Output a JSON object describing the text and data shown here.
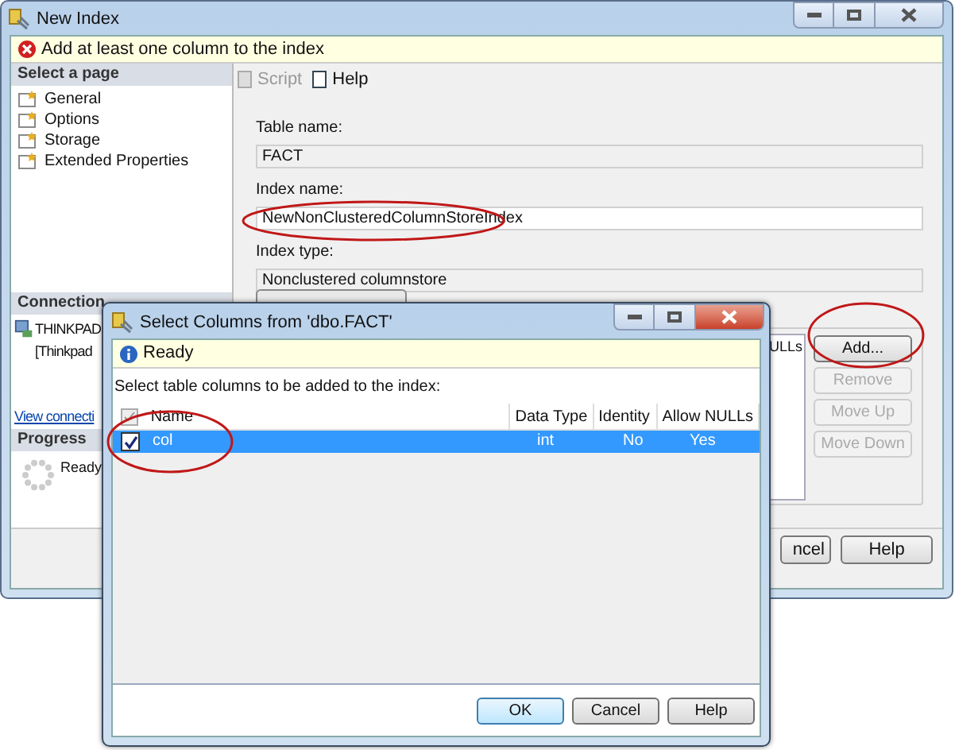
{
  "main_window": {
    "title": "New Index",
    "error": "Add at least one column to the index",
    "sidebar": {
      "header": "Select a page",
      "items": [
        {
          "label": "General"
        },
        {
          "label": "Options"
        },
        {
          "label": "Storage"
        },
        {
          "label": "Extended Properties"
        }
      ]
    },
    "connection": {
      "header": "Connection",
      "server": "THINKPAD",
      "user": "[Thinkpad",
      "link": "View connecti"
    },
    "progress": {
      "header": "Progress",
      "status": "Ready"
    },
    "toolbar": [
      {
        "label": "Script",
        "disabled": true
      },
      {
        "label": "Help",
        "disabled": false
      }
    ],
    "fields": [
      {
        "label": "Table name:",
        "value": "FACT",
        "editable": false
      },
      {
        "label": "Index name:",
        "value": "NewNonClusteredColumnStoreIndex",
        "editable": true
      },
      {
        "label": "Index type:",
        "value": "Nonclustered columnstore",
        "editable": false
      }
    ],
    "columns_list": {
      "header_fragment": "ULLs"
    },
    "side_buttons": [
      {
        "label": "Add...",
        "disabled": false
      },
      {
        "label": "Remove",
        "disabled": true
      },
      {
        "label": "Move Up",
        "disabled": true
      },
      {
        "label": "Move Down",
        "disabled": true
      }
    ],
    "footer_buttons": [
      "ncel",
      "Help"
    ]
  },
  "dialog": {
    "title": "Select Columns from 'dbo.FACT'",
    "status": "Ready",
    "prompt": "Select table columns to be added to the index:",
    "columns": [
      "Name",
      "Data Type",
      "Identity",
      "Allow NULLs"
    ],
    "rows": [
      {
        "cells": [
          "col",
          "int",
          "No",
          "Yes"
        ],
        "checked": true,
        "selected": true
      }
    ],
    "buttons": [
      {
        "label": "OK",
        "default": true
      },
      {
        "label": "Cancel",
        "default": false
      },
      {
        "label": "Help",
        "default": false
      }
    ]
  }
}
